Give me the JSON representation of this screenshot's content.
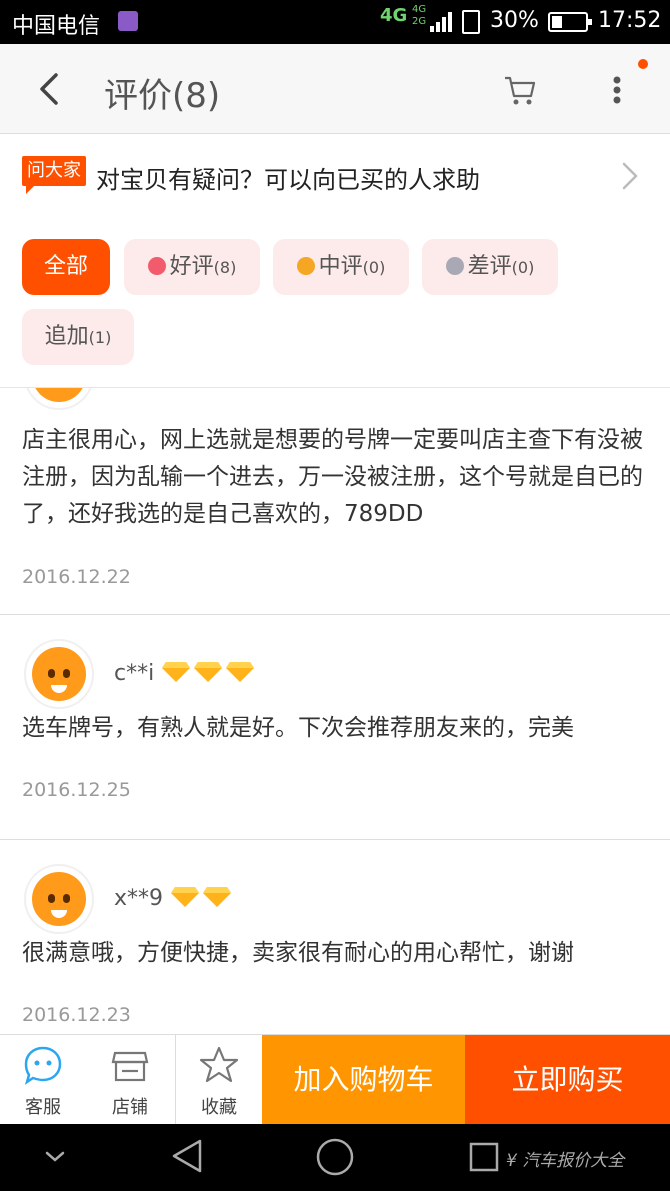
{
  "status_bar": {
    "carrier": "中国电信",
    "network": "4G",
    "network_extra": [
      "4G",
      "2G"
    ],
    "battery": "30%",
    "time": "17:52"
  },
  "header": {
    "title": "评价(8)",
    "icons": [
      "back-arrow-icon",
      "cart-icon",
      "more-vertical-icon"
    ]
  },
  "ask_banner": {
    "tag": "问大家",
    "text": "对宝贝有疑问？可以向已买的人求助"
  },
  "filters": [
    {
      "label": "全部",
      "count": "",
      "active": true
    },
    {
      "label": "好评",
      "count": "(8)",
      "active": false,
      "icon": "flower-red-icon"
    },
    {
      "label": "中评",
      "count": "(0)",
      "active": false,
      "icon": "flower-orange-icon"
    },
    {
      "label": "差评",
      "count": "(0)",
      "active": false,
      "icon": "flower-gray-icon"
    },
    {
      "label": "追加",
      "count": "(1)",
      "active": false
    }
  ],
  "reviews": [
    {
      "user": "",
      "text": "店主很用心，网上选就是想要的号牌一定要叫店主查下有没被注册，因为乱输一个进去，万一没被注册，这个号就是自已的了，还好我选的是自己喜欢的，789DD",
      "date": "2016.12.22"
    },
    {
      "user": "c**i",
      "level_gems": 3,
      "text": "选车牌号，有熟人就是好。下次会推荐朋友来的，完美",
      "date": "2016.12.25"
    },
    {
      "user": "x**9",
      "level_gems": 2,
      "text": "很满意哦，方便快捷，卖家很有耐心的用心帮忙，谢谢",
      "date": "2016.12.23"
    }
  ],
  "bottom_bar": {
    "service": "客服",
    "shop": "店铺",
    "favorite": "收藏",
    "add_cart": "加入购物车",
    "buy_now": "立即购买"
  },
  "nav_bar": {
    "watermark": "¥ 汽车报价大全"
  },
  "colors": {
    "accent": "#ff5000",
    "add_cart_bg": "#ff9500",
    "chip_bg": "#fdeaea"
  }
}
